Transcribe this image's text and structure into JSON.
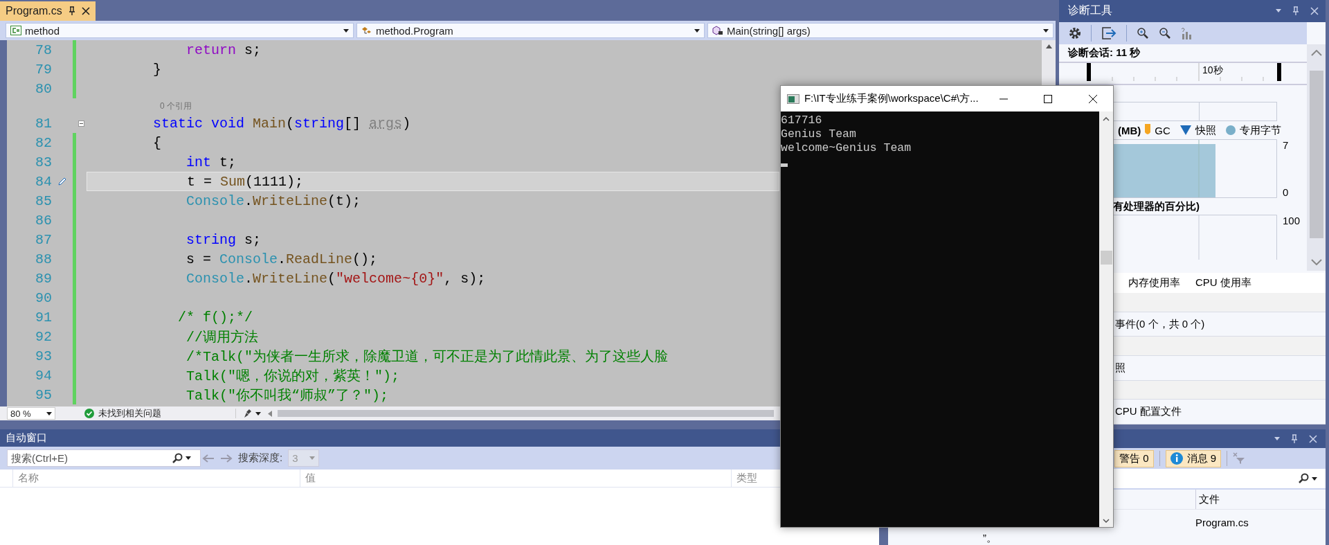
{
  "editor_tab": {
    "title": "Program.cs",
    "selected": true
  },
  "nav": {
    "project": "method",
    "class": "method.Program",
    "member": "Main(string[] args)"
  },
  "code_lines": [
    {
      "kind": "code",
      "number": "78",
      "changed": true,
      "tokens": [
        {
          "text": "            return",
          "kind": "control"
        },
        {
          "text": " s;",
          "kind": "plain"
        }
      ]
    },
    {
      "kind": "code",
      "number": "79",
      "changed": true,
      "tokens": [
        {
          "text": "        }",
          "kind": "plain"
        }
      ]
    },
    {
      "kind": "code",
      "number": "80",
      "changed": true
    },
    {
      "kind": "codelens",
      "text": "0 个引用"
    },
    {
      "kind": "code",
      "number": "81",
      "changed": false,
      "collapsible": true,
      "tokens": [
        {
          "text": "        static void ",
          "kind": "keyword"
        },
        {
          "text": "Main",
          "kind": "method"
        },
        {
          "text": "(",
          "kind": "plain"
        },
        {
          "text": "string",
          "kind": "keyword"
        },
        {
          "text": "[] ",
          "kind": "plain"
        },
        {
          "text": "args",
          "kind": "unused"
        },
        {
          "text": ")",
          "kind": "plain"
        }
      ]
    },
    {
      "kind": "code",
      "number": "82",
      "changed": true,
      "tokens": [
        {
          "text": "        {",
          "kind": "plain"
        }
      ]
    },
    {
      "kind": "code",
      "number": "83",
      "changed": true,
      "tokens": [
        {
          "text": "            int",
          "kind": "keyword"
        },
        {
          "text": " t;",
          "kind": "plain"
        }
      ]
    },
    {
      "kind": "code",
      "number": "84",
      "changed": true,
      "current": true,
      "tokens": [
        {
          "text": "            t = ",
          "kind": "plain"
        },
        {
          "text": "Sum",
          "kind": "method"
        },
        {
          "text": "(1111);",
          "kind": "plain"
        }
      ]
    },
    {
      "kind": "code",
      "number": "85",
      "changed": true,
      "tokens": [
        {
          "text": "            Console",
          "kind": "type"
        },
        {
          "text": ".",
          "kind": "plain"
        },
        {
          "text": "WriteLine",
          "kind": "method"
        },
        {
          "text": "(t);",
          "kind": "plain"
        }
      ]
    },
    {
      "kind": "code",
      "number": "86",
      "changed": true
    },
    {
      "kind": "code",
      "number": "87",
      "changed": true,
      "tokens": [
        {
          "text": "            string",
          "kind": "keyword"
        },
        {
          "text": " s;",
          "kind": "plain"
        }
      ]
    },
    {
      "kind": "code",
      "number": "88",
      "changed": true,
      "tokens": [
        {
          "text": "            s = ",
          "kind": "plain"
        },
        {
          "text": "Console",
          "kind": "type"
        },
        {
          "text": ".",
          "kind": "plain"
        },
        {
          "text": "ReadLine",
          "kind": "method"
        },
        {
          "text": "();",
          "kind": "plain"
        }
      ]
    },
    {
      "kind": "code",
      "number": "89",
      "changed": true,
      "tokens": [
        {
          "text": "            Console",
          "kind": "type"
        },
        {
          "text": ".",
          "kind": "plain"
        },
        {
          "text": "WriteLine",
          "kind": "method"
        },
        {
          "text": "(",
          "kind": "plain"
        },
        {
          "text": "\"welcome~{0}\"",
          "kind": "string"
        },
        {
          "text": ", s);",
          "kind": "plain"
        }
      ]
    },
    {
      "kind": "code",
      "number": "90",
      "changed": true
    },
    {
      "kind": "code",
      "number": "91",
      "changed": true,
      "tokens": [
        {
          "text": "           /* f();*/",
          "kind": "comment"
        }
      ]
    },
    {
      "kind": "code",
      "number": "92",
      "changed": true,
      "tokens": [
        {
          "text": "            //调用方法",
          "kind": "comment"
        }
      ]
    },
    {
      "kind": "code",
      "number": "93",
      "changed": true,
      "tokens": [
        {
          "text": "            /*Talk(\"为侠者一生所求，除魔卫道，可不正是为了此情此景、为了这些人脸",
          "kind": "comment"
        }
      ]
    },
    {
      "kind": "code",
      "number": "94",
      "changed": true,
      "tokens": [
        {
          "text": "            Talk(\"嗯，你说的对，紫英！\");",
          "kind": "comment"
        }
      ]
    },
    {
      "kind": "code",
      "number": "95",
      "changed": true,
      "tokens": [
        {
          "text": "            Talk(\"你不叫我“师叔”了？\");",
          "kind": "comment"
        }
      ]
    }
  ],
  "editor_status": {
    "zoom": "80 %",
    "issues": "未找到相关问题"
  },
  "autos": {
    "title": "自动窗口",
    "search_placeholder": "搜索(Ctrl+E)",
    "depth_label": "搜索深度:",
    "depth_value": "3",
    "depth_disabled": true,
    "columns": [
      "名称",
      "值",
      "类型"
    ]
  },
  "diagnostics": {
    "title": "诊断工具",
    "session": "诊断会话: 11 秒",
    "ruler_label": "10秒",
    "legend": [
      {
        "label": "(MB)",
        "kind": "heading"
      },
      {
        "label": "GC",
        "kind": "gc"
      },
      {
        "label": "快照",
        "kind": "snapshot"
      },
      {
        "label": "专用字节",
        "kind": "private"
      }
    ],
    "memory_axis": [
      "7",
      "0"
    ],
    "cpu_heading": "有处理器的百分比)",
    "cpu_axis": "100",
    "tabs": [
      "内存使用率",
      "CPU 使用率"
    ],
    "sections": [
      {
        "kind": "header"
      },
      {
        "kind": "item",
        "text": "事件(0 个，共 0 个)"
      },
      {
        "kind": "header"
      },
      {
        "kind": "item",
        "text": "照"
      },
      {
        "kind": "header"
      },
      {
        "kind": "item",
        "text": "CPU 配置文件"
      }
    ]
  },
  "error_list": {
    "badges": [
      {
        "label": "警告 0",
        "kind": "warning"
      },
      {
        "label": "消息 9",
        "kind": "message"
      }
    ],
    "column": "文件",
    "rows": [
      {
        "description": "”。",
        "file": "Program.cs"
      }
    ]
  },
  "console": {
    "title": "F:\\IT专业练手案例\\workspace\\C#\\方...",
    "lines": [
      "617716",
      "Genius Team",
      "welcome~Genius Team"
    ]
  }
}
